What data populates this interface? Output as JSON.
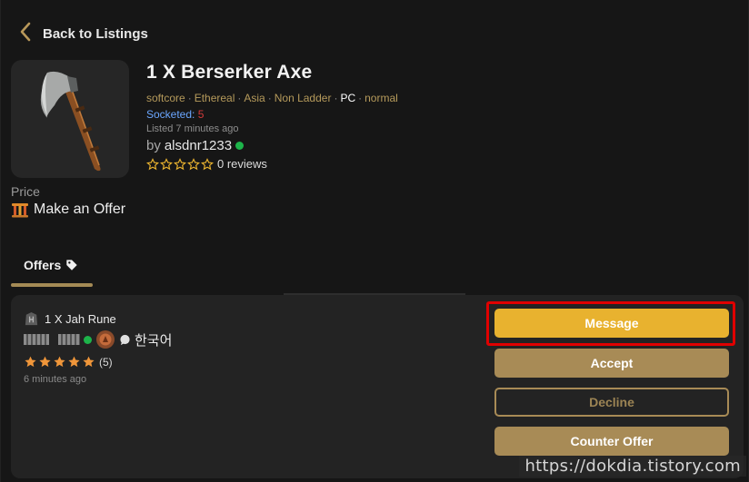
{
  "nav": {
    "back_label": "Back to Listings"
  },
  "listing": {
    "title": "1 X Berserker Axe",
    "tags": [
      "softcore",
      "Ethereal",
      "Asia",
      "Non Ladder",
      "PC",
      "normal"
    ],
    "socketed_label": "Socketed:",
    "socketed_value": "5",
    "listed": "Listed 7 minutes ago",
    "seller_prefix": "by",
    "seller_name": "alsdnr1233",
    "rating_stars": 0,
    "reviews_label": "0 reviews"
  },
  "price": {
    "label": "Price",
    "value": "Make an Offer"
  },
  "tabs": {
    "offers_label": "Offers"
  },
  "offer": {
    "item": "1 X Jah Rune",
    "language": "한국어",
    "rating_stars": 5,
    "review_count": "(5)",
    "time": "6 minutes ago",
    "buttons": {
      "message": "Message",
      "accept": "Accept",
      "decline": "Decline",
      "counter": "Counter Offer"
    }
  },
  "colors": {
    "gold": "#e8b22f",
    "muted_gold": "#a88b56",
    "online": "#1db44a",
    "socket_value": "#d13a3a",
    "socket_label": "#6aa6ff",
    "highlight": "#e00000"
  },
  "watermark": "https://dokdia.tistory.com"
}
